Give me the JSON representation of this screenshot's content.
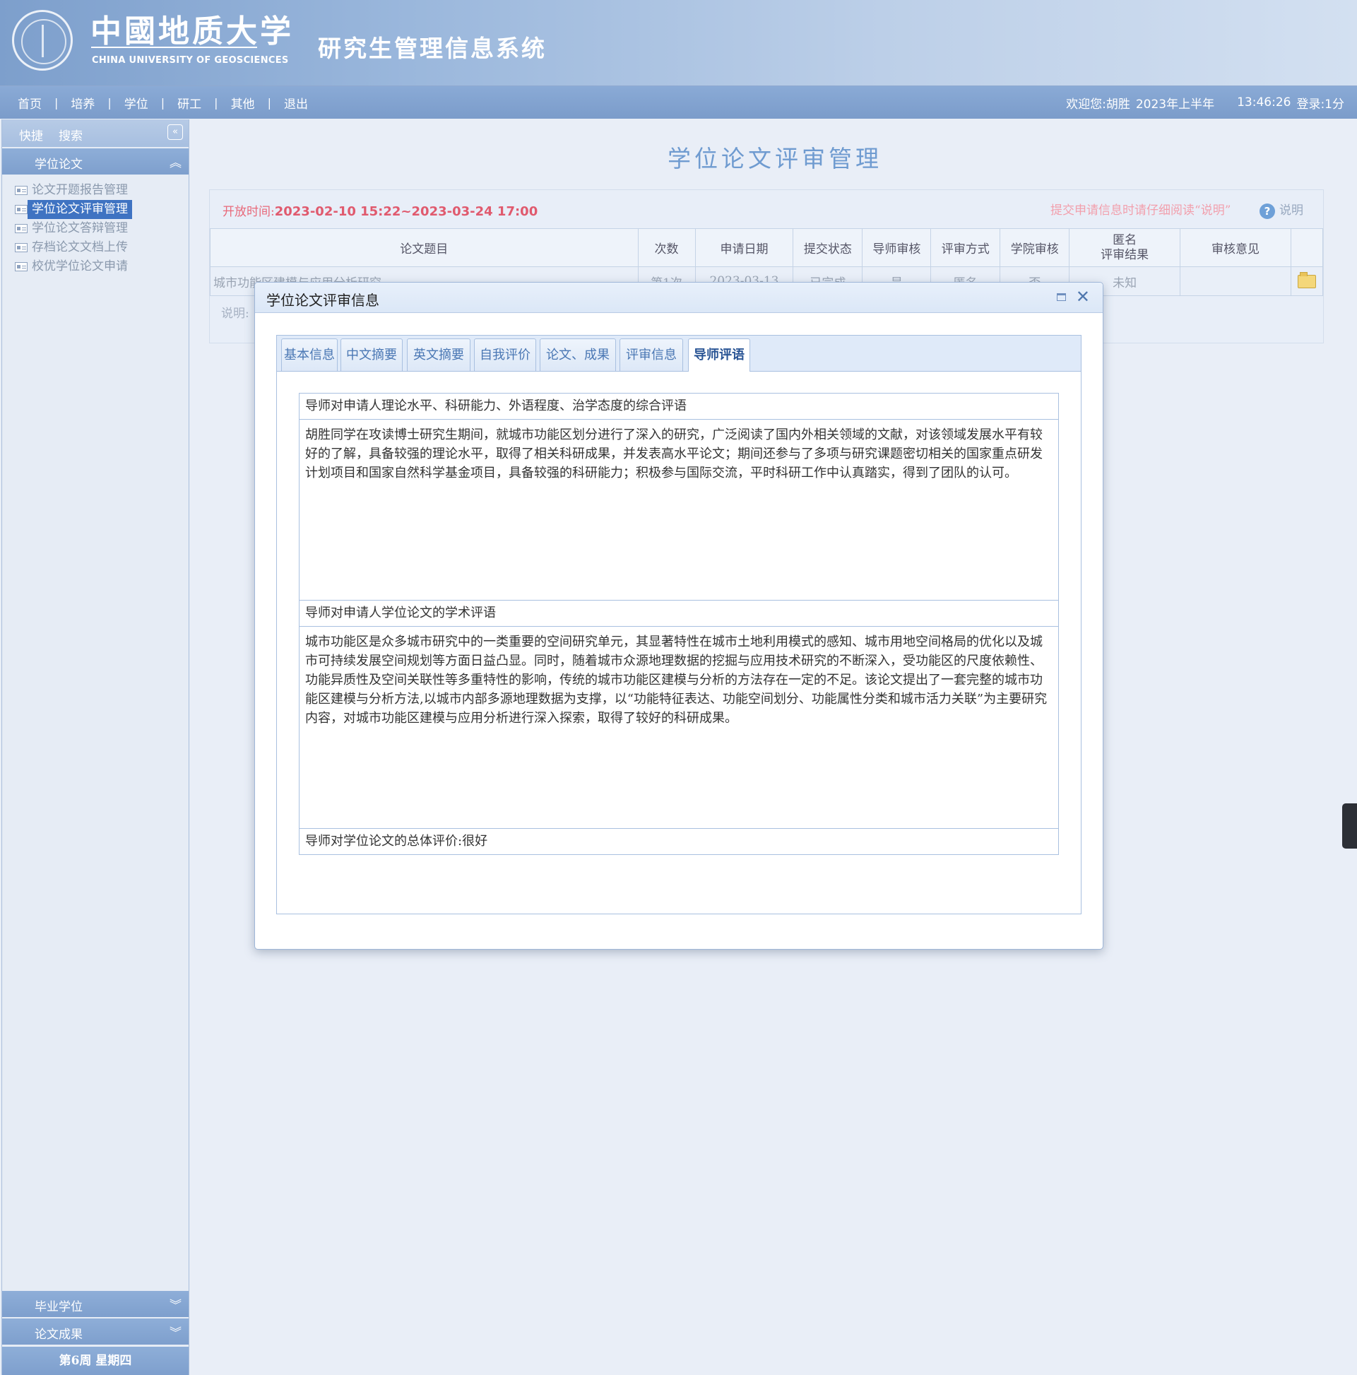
{
  "header": {
    "logo_cn": "中國地质大学",
    "logo_en": "CHINA UNIVERSITY OF GEOSCIENCES",
    "system_title": "研究生管理信息系统"
  },
  "nav": {
    "items": [
      "首页",
      "培养",
      "学位",
      "研工",
      "其他",
      "退出"
    ],
    "welcome": "欢迎您:胡胜",
    "term": "2023年上半年",
    "clock": "13:46:26",
    "login": "登录:1分"
  },
  "sidebar": {
    "quick": "快捷",
    "search": "搜索",
    "section_thesis": "学位论文",
    "menu": [
      "论文开题报告管理",
      "学位论文评审管理",
      "学位论文答辩管理",
      "存档论文文档上传",
      "校优学位论文申请"
    ],
    "section_graduation": "毕业学位",
    "section_results": "论文成果",
    "week": "第6周 星期四"
  },
  "main": {
    "title": "学位论文评审管理",
    "open_time_label": "开放时间:",
    "open_time_value": "2023-02-10 15:22~2023-03-24 17:00",
    "notice": "提交申请信息时请仔细阅读“说明”",
    "help": "说明",
    "note_prefix": "说明:",
    "table": {
      "headers": [
        "论文题目",
        "次数",
        "申请日期",
        "提交状态",
        "导师审核",
        "评审方式",
        "学院审核",
        "匿名\n评审结果",
        "审核意见",
        ""
      ],
      "rows": [
        [
          "城市功能区建模与应用分析研究",
          "第1次",
          "2023-03-13",
          "已完成",
          "是",
          "匿名",
          "否",
          "未知",
          ""
        ]
      ]
    }
  },
  "dialog": {
    "title": "学位论文评审信息",
    "tabs": [
      "基本信息",
      "中文摘要",
      "英文摘要",
      "自我评价",
      "论文、成果",
      "评审信息",
      "导师评语"
    ],
    "active_tab": "导师评语",
    "comment1_label": "导师对申请人理论水平、科研能力、外语程度、治学态度的综合评语",
    "comment1_text": "胡胜同学在攻读博士研究生期间，就城市功能区划分进行了深入的研究，广泛阅读了国内外相关领域的文献，对该领域发展水平有较好的了解，具备较强的理论水平，取得了相关科研成果，并发表高水平论文；期间还参与了多项与研究课题密切相关的国家重点研发计划项目和国家自然科学基金项目，具备较强的科研能力；积极参与国际交流，平时科研工作中认真踏实，得到了团队的认可。",
    "comment2_label": "导师对申请人学位论文的学术评语",
    "comment2_text": "城市功能区是众多城市研究中的一类重要的空间研究单元，其显著特性在城市土地利用模式的感知、城市用地空间格局的优化以及城市可持续发展空间规划等方面日益凸显。同时，随着城市众源地理数据的挖掘与应用技术研究的不断深入，受功能区的尺度依赖性、功能异质性及空间关联性等多重特性的影响，传统的城市功能区建模与分析的方法存在一定的不足。该论文提出了一套完整的城市功能区建模与分析方法,以城市内部多源地理数据为支撑，以“功能特征表达、功能空间划分、功能属性分类和城市活力关联”为主要研究内容，对城市功能区建模与应用分析进行深入探索，取得了较好的科研成果。",
    "overall_label": "导师对学位论文的总体评价:很好"
  }
}
